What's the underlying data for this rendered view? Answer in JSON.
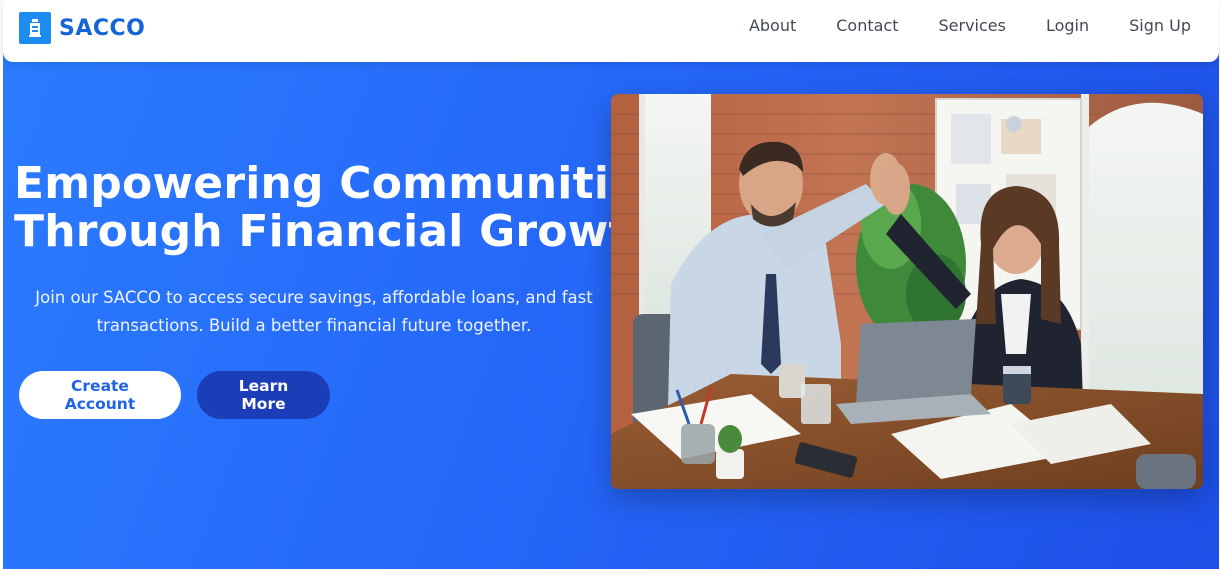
{
  "brand": {
    "name": "SACCO",
    "icon": "bank-building-icon",
    "color": "#1565d8"
  },
  "nav": {
    "items": [
      {
        "label": "About"
      },
      {
        "label": "Contact"
      },
      {
        "label": "Services"
      },
      {
        "label": "Login"
      },
      {
        "label": "Sign Up"
      }
    ]
  },
  "hero": {
    "headline_line1": "Empowering Communities",
    "headline_line2": "Through Financial Growth",
    "subtext": "Join our SACCO to access secure savings, affordable loans, and fast transactions. Build a better financial future together.",
    "primary_button": "Create Account",
    "secondary_button": "Learn More",
    "background_gradient": [
      "#2b7bff",
      "#1e4fe6"
    ],
    "image": "office-high-five-photo"
  }
}
